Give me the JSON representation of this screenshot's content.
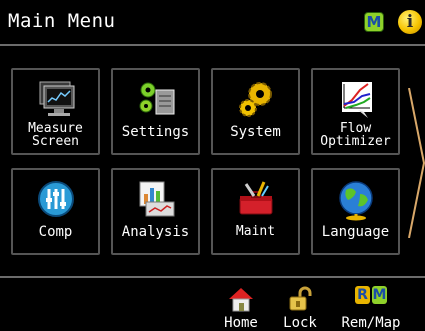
{
  "header": {
    "title": "Main Menu",
    "m_badge": "M",
    "info_badge": "i"
  },
  "tiles": [
    {
      "label": "Measure Screen",
      "line1": "Measure",
      "line2": "Screen",
      "icon": "monitor-graph-icon"
    },
    {
      "label": "Settings",
      "icon": "gears-icon"
    },
    {
      "label": "System",
      "icon": "system-gears-icon"
    },
    {
      "label": "Flow Optimizer",
      "line1": "Flow",
      "line2": "Optimizer",
      "icon": "flow-chart-icon"
    },
    {
      "label": "Comp",
      "icon": "comp-sliders-icon"
    },
    {
      "label": "Analysis",
      "icon": "analysis-chart-icon"
    },
    {
      "label": "Maint",
      "icon": "toolbox-icon"
    },
    {
      "label": "Language",
      "icon": "globe-icon"
    }
  ],
  "bottom": {
    "home": "Home",
    "lock": "Lock",
    "remmap": "Rem/Map",
    "r_badge": "R",
    "m_badge": "M"
  },
  "colors": {
    "accent_green": "#8fd12a",
    "info_yellow": "#f6c400",
    "border": "#555555"
  }
}
